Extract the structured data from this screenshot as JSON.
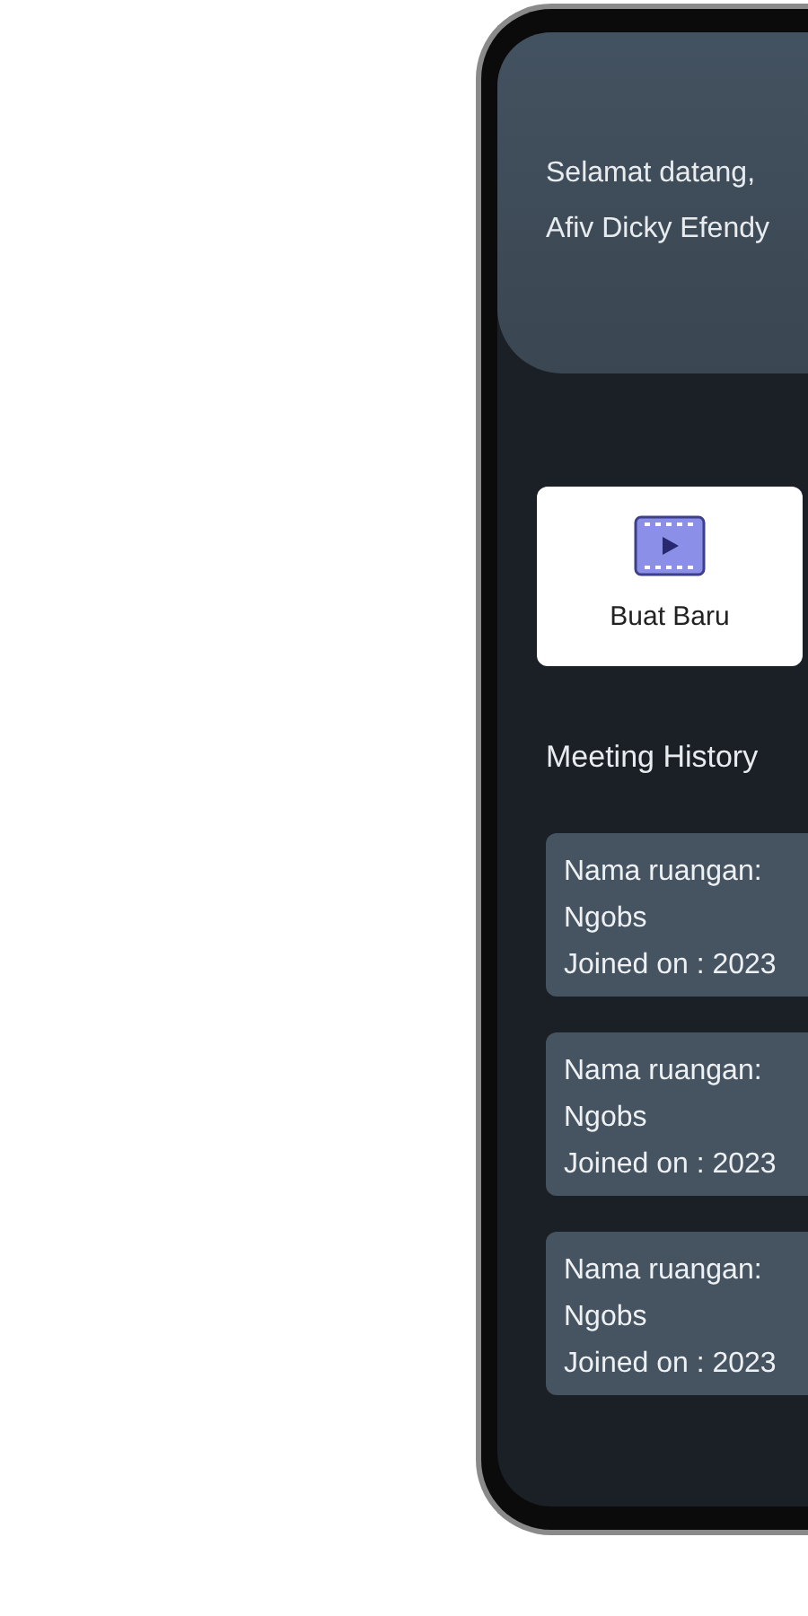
{
  "header": {
    "greeting": "Selamat datang,",
    "user_name": "Afiv Dicky Efendy"
  },
  "new_button": {
    "label": "Buat Baru"
  },
  "history": {
    "title": "Meeting History",
    "items": [
      {
        "room_label": "Nama ruangan:",
        "room_name": "Ngobs",
        "joined": "Joined on : 2023"
      },
      {
        "room_label": "Nama ruangan:",
        "room_name": "Ngobs",
        "joined": "Joined on : 2023"
      },
      {
        "room_label": "Nama ruangan:",
        "room_name": "Ngobs",
        "joined": "Joined on : 2023"
      }
    ]
  }
}
